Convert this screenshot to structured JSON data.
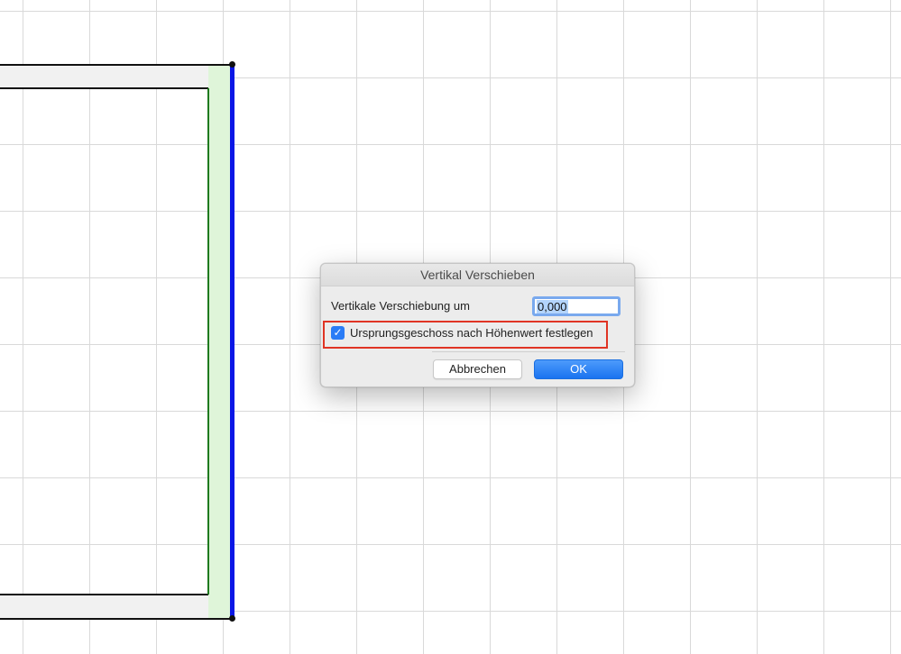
{
  "canvas": {
    "grid_color": "#d9d9d9",
    "selected_edge_color": "#0a17e6",
    "wall_fill_color": "#dff5d9"
  },
  "dialog": {
    "title": "Vertikal Verschieben",
    "offset_label": "Vertikale Verschiebung um",
    "offset_value": "0,000",
    "checkbox_label": "Ursprungsgeschoss nach Höhenwert festlegen",
    "checkbox_checked": true,
    "cancel_label": "Abbrechen",
    "ok_label": "OK",
    "highlight_color": "#e03424",
    "accent_color": "#2a7cf6"
  }
}
